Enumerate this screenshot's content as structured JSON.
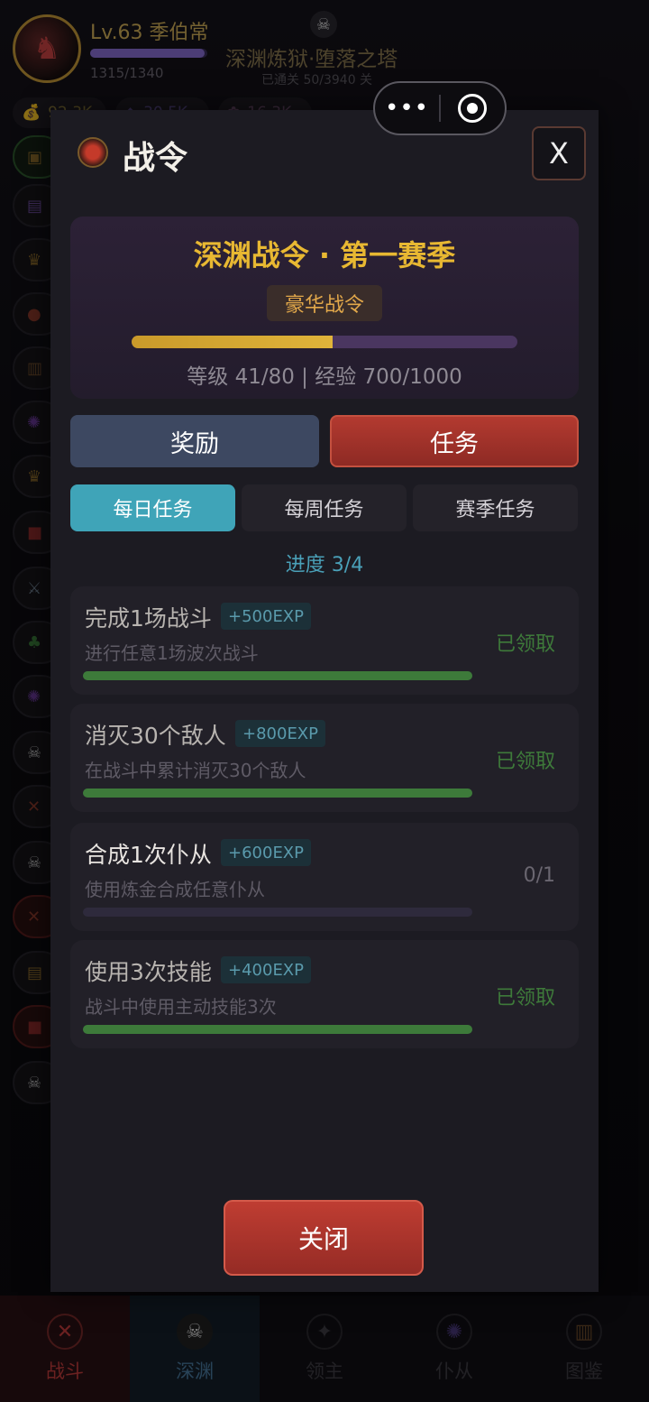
{
  "player": {
    "level": "Lv.63 季伯常",
    "exp": "1315/1340",
    "exp_fraction": 0.98
  },
  "stage": {
    "name": "深渊炼狱·堕落之塔",
    "cleared": "已通关 50/3940 关"
  },
  "resources": [
    "92.3K",
    "30.5K",
    "16.3K"
  ],
  "modal": {
    "title": "战令",
    "close_x": "X",
    "season": {
      "name": "深渊战令 · 第一赛季",
      "tier": "豪华战令",
      "progress_fraction": 0.52,
      "stat": "等级 41/80 | 经验 700/1000"
    },
    "tabs": {
      "reward": "奖励",
      "task": "任务",
      "active": "task"
    },
    "subtabs": {
      "daily": "每日任务",
      "weekly": "每周任务",
      "season": "赛季任务",
      "active": "daily"
    },
    "progress": "进度 3/4",
    "tasks": [
      {
        "name": "完成1场战斗",
        "exp": "+500EXP",
        "desc": "进行任意1场波次战斗",
        "status": "已领取",
        "fraction": 1.0,
        "done": true
      },
      {
        "name": "消灭30个敌人",
        "exp": "+800EXP",
        "desc": "在战斗中累计消灭30个敌人",
        "status": "已领取",
        "fraction": 1.0,
        "done": true
      },
      {
        "name": "合成1次仆从",
        "exp": "+600EXP",
        "desc": "使用炼金合成任意仆从",
        "status": "0/1",
        "fraction": 0.0,
        "done": false
      },
      {
        "name": "使用3次技能",
        "exp": "+400EXP",
        "desc": "战斗中使用主动技能3次",
        "status": "已领取",
        "fraction": 1.0,
        "done": true
      }
    ],
    "close_button": "关闭"
  },
  "nav": {
    "items": [
      {
        "label": "战斗",
        "icon": "crossed-swords-icon"
      },
      {
        "label": "深渊",
        "icon": "skull-icon"
      },
      {
        "label": "领主",
        "icon": "crest-icon"
      },
      {
        "label": "仆从",
        "icon": "rune-icon"
      },
      {
        "label": "图鉴",
        "icon": "book-icon"
      }
    ],
    "active": 1
  },
  "colors": {
    "accent_gold": "#e8b832",
    "task_red": "#b33a30",
    "daily_cyan": "#3fa4b8",
    "done_green": "#3e7a3a"
  }
}
